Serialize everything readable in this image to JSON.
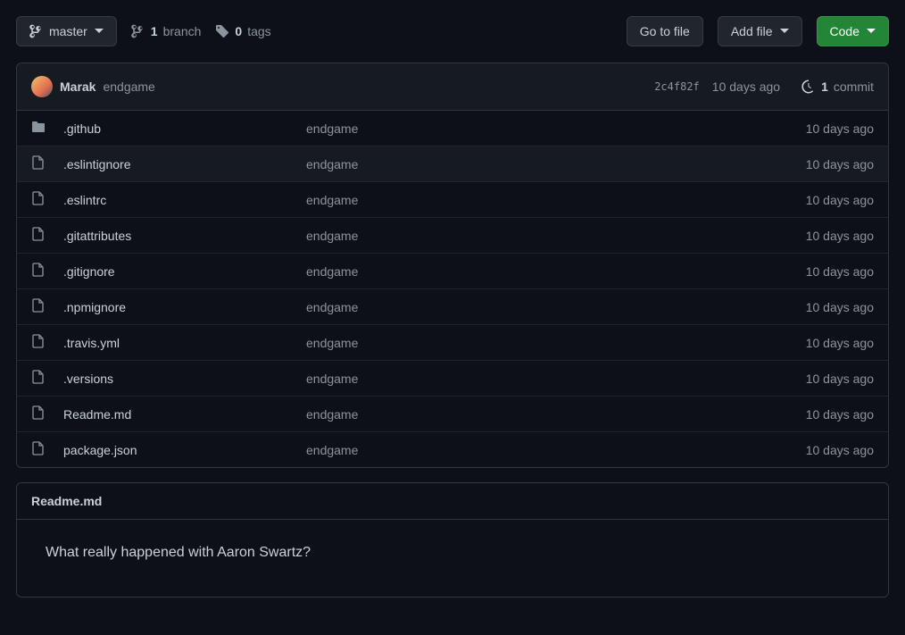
{
  "toolbar": {
    "branch_label": "master",
    "branch_count": "1",
    "branch_word": "branch",
    "tag_count": "0",
    "tag_word": "tags",
    "go_to_file": "Go to file",
    "add_file": "Add file",
    "code": "Code"
  },
  "commit": {
    "author": "Marak",
    "message": "endgame",
    "sha": "2c4f82f",
    "time": "10 days ago",
    "commit_count": "1",
    "commit_word": "commit"
  },
  "files": [
    {
      "type": "dir",
      "name": ".github",
      "msg": "endgame",
      "time": "10 days ago"
    },
    {
      "type": "file",
      "name": ".eslintignore",
      "msg": "endgame",
      "time": "10 days ago",
      "hovered": true
    },
    {
      "type": "file",
      "name": ".eslintrc",
      "msg": "endgame",
      "time": "10 days ago"
    },
    {
      "type": "file",
      "name": ".gitattributes",
      "msg": "endgame",
      "time": "10 days ago"
    },
    {
      "type": "file",
      "name": ".gitignore",
      "msg": "endgame",
      "time": "10 days ago"
    },
    {
      "type": "file",
      "name": ".npmignore",
      "msg": "endgame",
      "time": "10 days ago"
    },
    {
      "type": "file",
      "name": ".travis.yml",
      "msg": "endgame",
      "time": "10 days ago"
    },
    {
      "type": "file",
      "name": ".versions",
      "msg": "endgame",
      "time": "10 days ago"
    },
    {
      "type": "file",
      "name": "Readme.md",
      "msg": "endgame",
      "time": "10 days ago"
    },
    {
      "type": "file",
      "name": "package.json",
      "msg": "endgame",
      "time": "10 days ago"
    }
  ],
  "readme": {
    "title": "Readme.md",
    "body": "What really happened with Aaron Swartz?"
  }
}
